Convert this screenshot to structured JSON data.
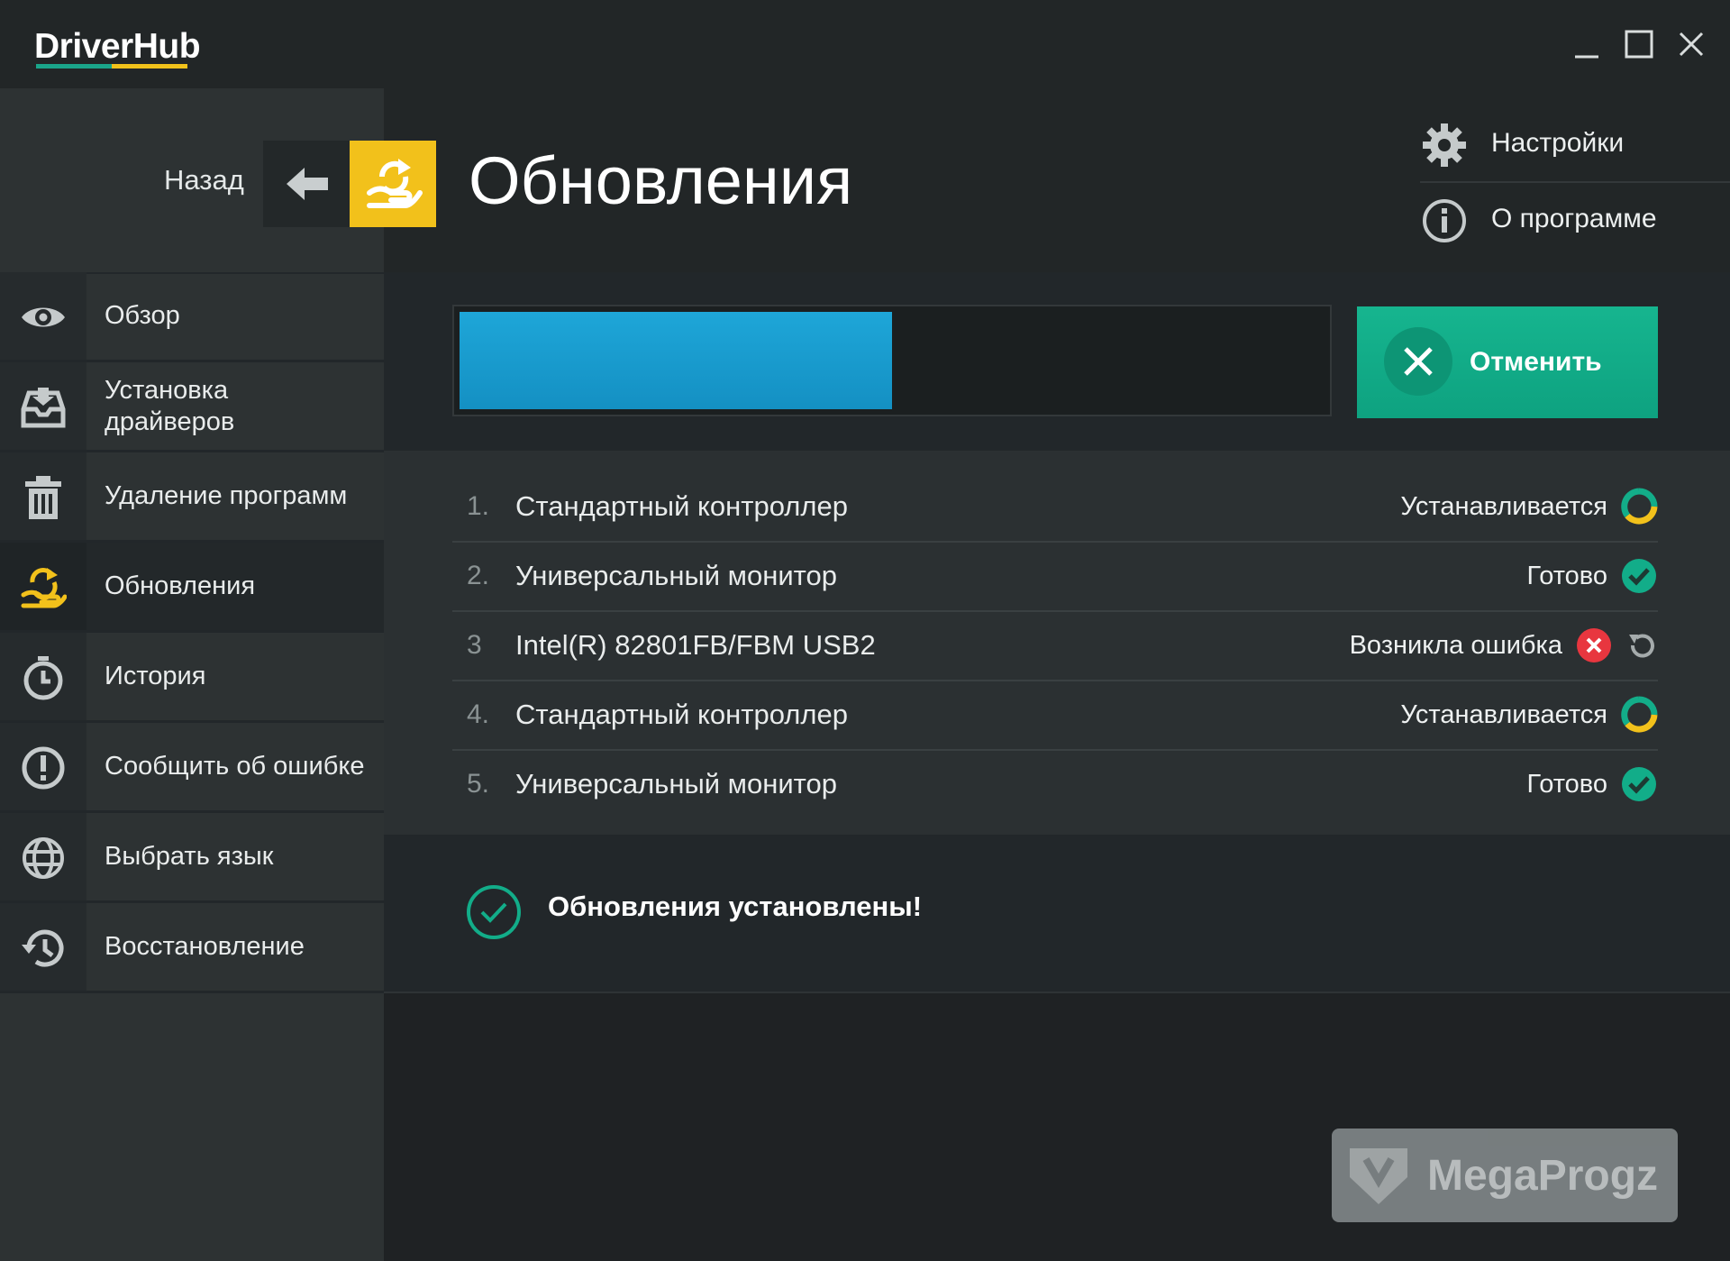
{
  "app": {
    "name": "DriverHub"
  },
  "window_controls": {
    "minimize_icon": "minimize-icon",
    "maximize_icon": "maximize-icon",
    "close_icon": "close-icon"
  },
  "sidebar": {
    "back_label": "Назад",
    "items": [
      {
        "label": "Обзор",
        "icon": "eye-icon",
        "active": false
      },
      {
        "label": "Установка\nдрайверов",
        "icon": "driver-install-icon",
        "active": false
      },
      {
        "label": "Удаление программ",
        "icon": "trash-icon",
        "active": false
      },
      {
        "label": "Обновления",
        "icon": "update-icon",
        "active": true
      },
      {
        "label": "История",
        "icon": "clock-icon",
        "active": false
      },
      {
        "label": "Сообщить об ошибке",
        "icon": "alert-icon",
        "active": false
      },
      {
        "label": "Выбрать язык",
        "icon": "globe-icon",
        "active": false
      },
      {
        "label": "Восстановление",
        "icon": "restore-icon",
        "active": false
      }
    ]
  },
  "header": {
    "title": "Обновления",
    "settings_label": "Настройки",
    "about_label": "О программе"
  },
  "progress": {
    "value": 0.5
  },
  "cancel_button": {
    "label": "Отменить"
  },
  "updates": [
    {
      "num": "1.",
      "name": "Стандартный контроллер",
      "status": "Устанавливается",
      "state": "installing"
    },
    {
      "num": "2.",
      "name": "Универсальный монитор",
      "status": "Готово",
      "state": "done"
    },
    {
      "num": "3",
      "name": "Intel(R) 82801FB/FBM USB2",
      "status": "Возникла ошибка",
      "state": "error"
    },
    {
      "num": "4.",
      "name": "Стандартный контроллер",
      "status": "Устанавливается",
      "state": "installing"
    },
    {
      "num": "5.",
      "name": "Универсальный монитор",
      "status": "Готово",
      "state": "done"
    }
  ],
  "completion_message": "Обновления установлены!",
  "watermark": {
    "text": "MegaProgz"
  },
  "colors": {
    "accent_yellow": "#f2c11b",
    "accent_green": "#12ad89",
    "progress_blue": "#1a9fd2",
    "error_red": "#e8363f"
  }
}
